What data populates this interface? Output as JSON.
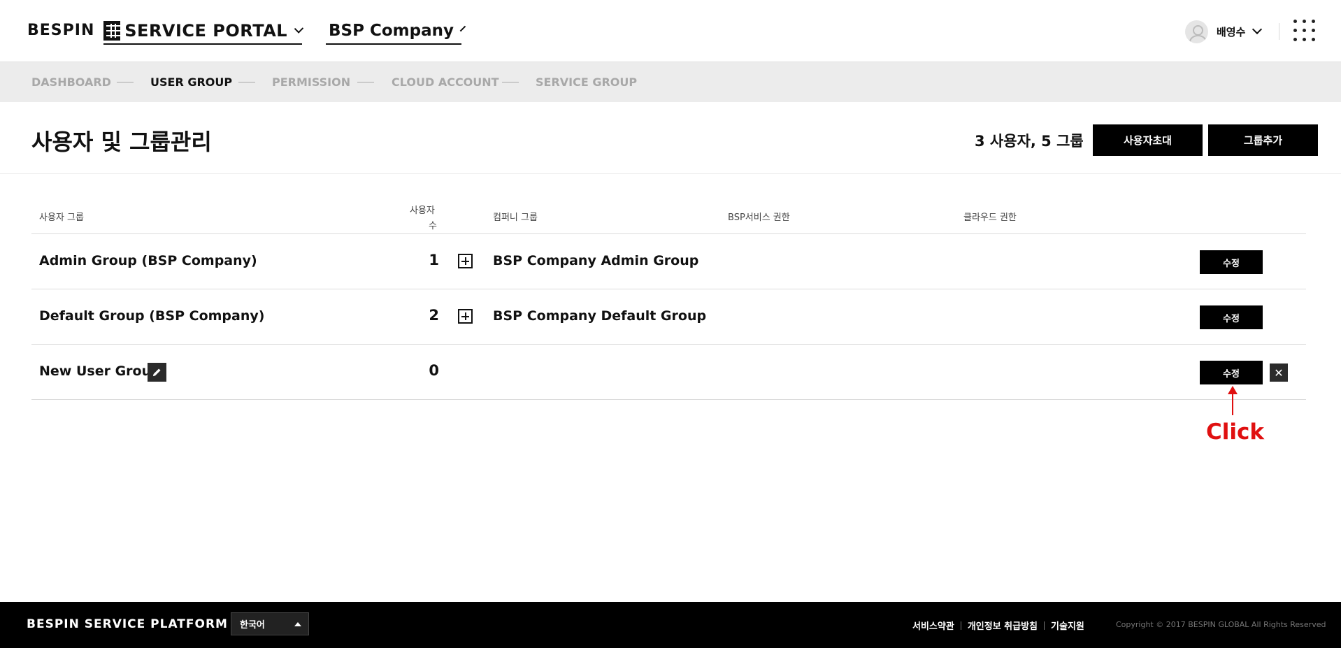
{
  "header": {
    "logo": "BESPIN",
    "portal_label": "SERVICE PORTAL",
    "company_label": "BSP Company",
    "user_name": "배영수"
  },
  "nav": {
    "items": [
      {
        "label": "DASHBOARD",
        "active": false
      },
      {
        "label": "USER GROUP",
        "active": true
      },
      {
        "label": "PERMISSION",
        "active": false
      },
      {
        "label": "CLOUD ACCOUNT",
        "active": false
      },
      {
        "label": "SERVICE GROUP",
        "active": false
      }
    ]
  },
  "page": {
    "title": "사용자 및 그룹관리",
    "counts": "3 사용자, 5 그룹",
    "invite_button": "사용자초대",
    "add_group_button": "그룹추가"
  },
  "table": {
    "headers": {
      "user_group": "사용자 그룹",
      "user_count_line1": "사용자",
      "user_count_line2": "수",
      "company_group": "컴퍼니 그룹",
      "bsp_permission": "BSP서비스 권한",
      "cloud_permission": "클라우드 권한"
    },
    "rows": [
      {
        "name": "Admin Group (BSP Company)",
        "count": "1",
        "company_group": "BSP Company Admin Group",
        "edit_label": "수정"
      },
      {
        "name": "Default Group (BSP Company)",
        "count": "2",
        "company_group": "BSP Company Default Group",
        "edit_label": "수정"
      },
      {
        "name": "New User Group",
        "count": "0",
        "company_group": "",
        "edit_label": "수정",
        "delete_label": "✕"
      }
    ]
  },
  "annotation": {
    "text": "Click",
    "color": "#e01010"
  },
  "footer": {
    "brand": "BESPIN SERVICE PLATFORM",
    "language": "한국어",
    "links": [
      "서비스약관",
      "개인정보 취급방침",
      "기술지원"
    ],
    "copyright": "Copyright © 2017 BESPIN GLOBAL All Rights Reserved"
  }
}
